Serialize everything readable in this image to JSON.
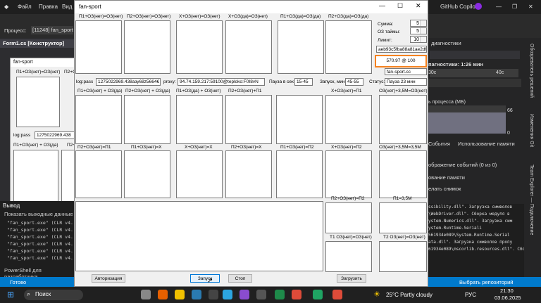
{
  "vs": {
    "menu": [
      "Файл",
      "Правка",
      "Вид"
    ],
    "process_label": "Процесс:",
    "process_value": "[11248] fan_sport",
    "designer_tab": "Form1.cs [Конструктор]",
    "designer_form_title": "fan-sport",
    "designer_caps": [
      "П1+ОЗ(нет)=ОЗ(нет)",
      "П2+О",
      "log:pass",
      "1275022969.438",
      "П1+ОЗ(нет) + ОЗ(да)",
      "П2+"
    ],
    "output_title": "Вывод",
    "output_show": "Показать выходные данные",
    "output_lines": [
      "\"fan_sport.exe\" (CLR v4.",
      "\"fan_sport.exe\" (CLR v4.",
      "\"fan_sport.exe\" (CLR v4.",
      "\"fan_sport.exe\" (CLR v4.",
      "\"fan_sport.exe\" (CLR v4.",
      "\"fan_sport.exe\" (CLR v4."
    ],
    "output_right": [
      "ssibility.dll\". Загрузка символов",
      "\\WebDriver.dll\". Сборка модуля в",
      "ystem.Numerics.dll\". Загрузка сим",
      "ystem.Runtime.Seriali",
      "561934e089\\System.Runtime.Serial",
      "ata.dll\". Загрузка символов пропу",
      "61934e089\\mscorlib.resources.dll\". Сборк"
    ],
    "powershell": "PowerShell для разработчика",
    "status_ready": "Готово",
    "status_right": "Выбрать репозиторий",
    "diag_title": "диагностики",
    "diag_session": "пагностики: 1:26 мин",
    "diag_30": "30c",
    "diag_40": "40c",
    "proc_memory": "ь процесса (МБ)",
    "axis_66": "66",
    "axis_0": "0",
    "diag_tabs": [
      "События",
      "Использование памяти"
    ],
    "diag_events": "ображение событий (0 из 0)",
    "diag_mem": "ование памяти",
    "diag_snap": "елать снимок",
    "copilot": "GitHub Copilot",
    "vtabs": [
      "Обозреватель решений",
      "Изменения Git",
      "Team Explorer — Подключение"
    ]
  },
  "app": {
    "title": "fan-sport",
    "boxes_row1": [
      "П1+ОЗ(нет)=ОЗ(нет)",
      "П2+ОЗ(нет)=ОЗ(нет)",
      "Х+ОЗ(нет)=ОЗ(нет)",
      "Х+ОЗ(да)=ОЗ(нет)",
      "П1+ОЗ(да)=ОЗ(да)",
      "П2+ОЗ(да)=ОЗ(да)"
    ],
    "boxes_row2": [
      "П1+ОЗ(нет) + ОЗ(да)",
      "П2+ОЗ(нет) + ОЗ(да)",
      "П1+ОЗ(да) + ОЗ(нет)",
      "П2+ОЗ(нет)+П1",
      "Х+ОЗ(нет)=П1",
      "ОЗ(нет)+3,5М=ОЗ(нет)"
    ],
    "boxes_row3": [
      "П2+ОЗ(нет)=П1",
      "П1+ОЗ(нет)=Х",
      "Х+ОЗ(нет)=Х",
      "П2+ОЗ(нет)=Х",
      "П1+ОЗ(нет)=П2",
      "Х+ОЗ(нет)=П2",
      "ОЗ(нет)+3,5М=3,5М"
    ],
    "box_p2_oz_p2": "П2+ОЗ(нет)=П2",
    "box_p1_35": "П1=3,5М",
    "box_t1": "Т1 ОЗ(нет)=ОЗ(нет)",
    "box_t2": "Т2 ОЗ(нет)=ОЗ(нет)",
    "summa_label": "Сумма:",
    "summa_value": "5",
    "oz_label": "ОЗ таймы:",
    "oz_value": "5",
    "limit_label": "Лимит:",
    "limit_value": "10",
    "hash_value": "aeb93c5fba88a81ae2df3c",
    "rate_value": "570.97 @  100",
    "site_value": "fan-sport.cc",
    "logpass_label": "log:pass",
    "logpass_value": "1275022969.438азу68z5664€",
    "proxy_label": "proxy:",
    "proxy_value": "94.74.159.217:59100@teploko:F0I8vN",
    "pause_label": "Пауза в сек",
    "pause_value": "15-45",
    "start_label": "Запуск, мин:",
    "start_value": "45-55",
    "status_label": "Статус:",
    "status_value": "Пауза 23 мин",
    "btn_auth": "Авторизация",
    "btn_start": "Запуск",
    "btn_stop": "Стоп",
    "btn_load": "Загрузить"
  },
  "taskbar": {
    "search": "Поиск",
    "weather": "25°C  Partly cloudy",
    "lang": "РУС",
    "time": "21:30",
    "date": "03.06.2025"
  },
  "colors": {
    "highlight": "#f58220",
    "vs_blue": "#007acc"
  }
}
